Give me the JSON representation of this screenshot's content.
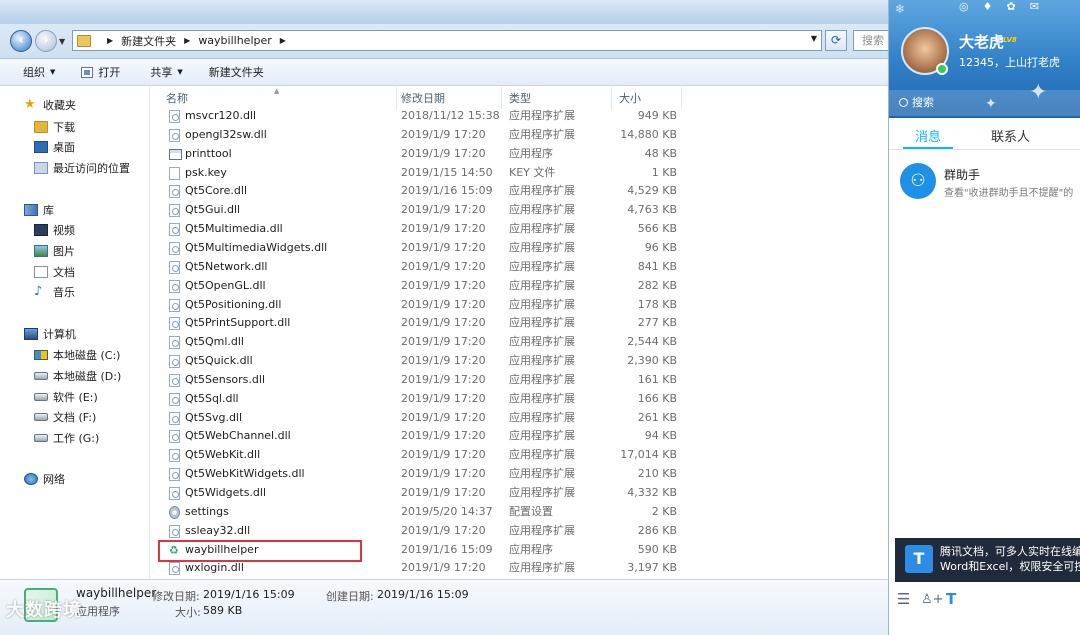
{
  "explorer": {
    "breadcrumb": [
      "新建文件夹",
      "waybillhelper"
    ],
    "search_placeholder": "搜索",
    "toolbar": {
      "organize": "组织",
      "open": "打开",
      "share": "共享",
      "new_folder": "新建文件夹"
    },
    "nav": {
      "favorites": "收藏夹",
      "downloads": "下载",
      "desktop": "桌面",
      "recent": "最近访问的位置",
      "libraries": "库",
      "videos": "视频",
      "pictures": "图片",
      "documents": "文档",
      "music": "音乐",
      "computer": "计算机",
      "drive_c": "本地磁盘 (C:)",
      "drive_d": "本地磁盘 (D:)",
      "drive_e": "软件 (E:)",
      "drive_f": "文档 (F:)",
      "drive_g": "工作 (G:)",
      "network": "网络"
    },
    "columns": {
      "name": "名称",
      "date": "修改日期",
      "type": "类型",
      "size": "大小"
    },
    "files": [
      {
        "name": "msvcr120.dll",
        "date": "2018/11/12 15:38",
        "type": "应用程序扩展",
        "size": "949 KB",
        "icon": "dll"
      },
      {
        "name": "opengl32sw.dll",
        "date": "2019/1/9 17:20",
        "type": "应用程序扩展",
        "size": "14,880 KB",
        "icon": "dll"
      },
      {
        "name": "printtool",
        "date": "2019/1/9 17:20",
        "type": "应用程序",
        "size": "48 KB",
        "icon": "exe"
      },
      {
        "name": "psk.key",
        "date": "2019/1/15 14:50",
        "type": "KEY 文件",
        "size": "1 KB",
        "icon": "file"
      },
      {
        "name": "Qt5Core.dll",
        "date": "2019/1/16 15:09",
        "type": "应用程序扩展",
        "size": "4,529 KB",
        "icon": "dll"
      },
      {
        "name": "Qt5Gui.dll",
        "date": "2019/1/9 17:20",
        "type": "应用程序扩展",
        "size": "4,763 KB",
        "icon": "dll"
      },
      {
        "name": "Qt5Multimedia.dll",
        "date": "2019/1/9 17:20",
        "type": "应用程序扩展",
        "size": "566 KB",
        "icon": "dll"
      },
      {
        "name": "Qt5MultimediaWidgets.dll",
        "date": "2019/1/9 17:20",
        "type": "应用程序扩展",
        "size": "96 KB",
        "icon": "dll"
      },
      {
        "name": "Qt5Network.dll",
        "date": "2019/1/9 17:20",
        "type": "应用程序扩展",
        "size": "841 KB",
        "icon": "dll"
      },
      {
        "name": "Qt5OpenGL.dll",
        "date": "2019/1/9 17:20",
        "type": "应用程序扩展",
        "size": "282 KB",
        "icon": "dll"
      },
      {
        "name": "Qt5Positioning.dll",
        "date": "2019/1/9 17:20",
        "type": "应用程序扩展",
        "size": "178 KB",
        "icon": "dll"
      },
      {
        "name": "Qt5PrintSupport.dll",
        "date": "2019/1/9 17:20",
        "type": "应用程序扩展",
        "size": "277 KB",
        "icon": "dll"
      },
      {
        "name": "Qt5Qml.dll",
        "date": "2019/1/9 17:20",
        "type": "应用程序扩展",
        "size": "2,544 KB",
        "icon": "dll"
      },
      {
        "name": "Qt5Quick.dll",
        "date": "2019/1/9 17:20",
        "type": "应用程序扩展",
        "size": "2,390 KB",
        "icon": "dll"
      },
      {
        "name": "Qt5Sensors.dll",
        "date": "2019/1/9 17:20",
        "type": "应用程序扩展",
        "size": "161 KB",
        "icon": "dll"
      },
      {
        "name": "Qt5Sql.dll",
        "date": "2019/1/9 17:20",
        "type": "应用程序扩展",
        "size": "166 KB",
        "icon": "dll"
      },
      {
        "name": "Qt5Svg.dll",
        "date": "2019/1/9 17:20",
        "type": "应用程序扩展",
        "size": "261 KB",
        "icon": "dll"
      },
      {
        "name": "Qt5WebChannel.dll",
        "date": "2019/1/9 17:20",
        "type": "应用程序扩展",
        "size": "94 KB",
        "icon": "dll"
      },
      {
        "name": "Qt5WebKit.dll",
        "date": "2019/1/9 17:20",
        "type": "应用程序扩展",
        "size": "17,014 KB",
        "icon": "dll"
      },
      {
        "name": "Qt5WebKitWidgets.dll",
        "date": "2019/1/9 17:20",
        "type": "应用程序扩展",
        "size": "210 KB",
        "icon": "dll"
      },
      {
        "name": "Qt5Widgets.dll",
        "date": "2019/1/9 17:20",
        "type": "应用程序扩展",
        "size": "4,332 KB",
        "icon": "dll"
      },
      {
        "name": "settings",
        "date": "2019/5/20 14:37",
        "type": "配置设置",
        "size": "2 KB",
        "icon": "gear"
      },
      {
        "name": "ssleay32.dll",
        "date": "2019/1/9 17:20",
        "type": "应用程序扩展",
        "size": "286 KB",
        "icon": "dll"
      },
      {
        "name": "waybillhelper",
        "date": "2019/1/16 15:09",
        "type": "应用程序",
        "size": "590 KB",
        "icon": "app"
      },
      {
        "name": "wxlogin.dll",
        "date": "2019/1/9 17:20",
        "type": "应用程序扩展",
        "size": "3,197 KB",
        "icon": "dll"
      }
    ],
    "details": {
      "name": "waybillhelper",
      "type": "应用程序",
      "modified_label": "修改日期:",
      "modified_value": "2019/1/16 15:09",
      "created_label": "创建日期:",
      "created_value": "2019/1/16 15:09",
      "size_label": "大小:",
      "size_value": "589 KB"
    },
    "watermark": "大数跨境"
  },
  "qq": {
    "nickname": "大老虎",
    "level_badge": "LV8",
    "signature": "12345，上山打老虎",
    "search_placeholder": "搜索",
    "tabs": {
      "messages": "消息",
      "contacts": "联系人"
    },
    "message": {
      "title": "群助手",
      "preview": "查看\"收进群助手且不提醒\"的"
    },
    "popup": {
      "line1": "腾讯文档，可多人实时在线编",
      "line2": "Word和Excel，权限安全可控"
    }
  },
  "colors": {
    "qq_accent": "#12b7f5",
    "highlight_box": "#d9363e",
    "qq_header": "#2f7fc7"
  }
}
